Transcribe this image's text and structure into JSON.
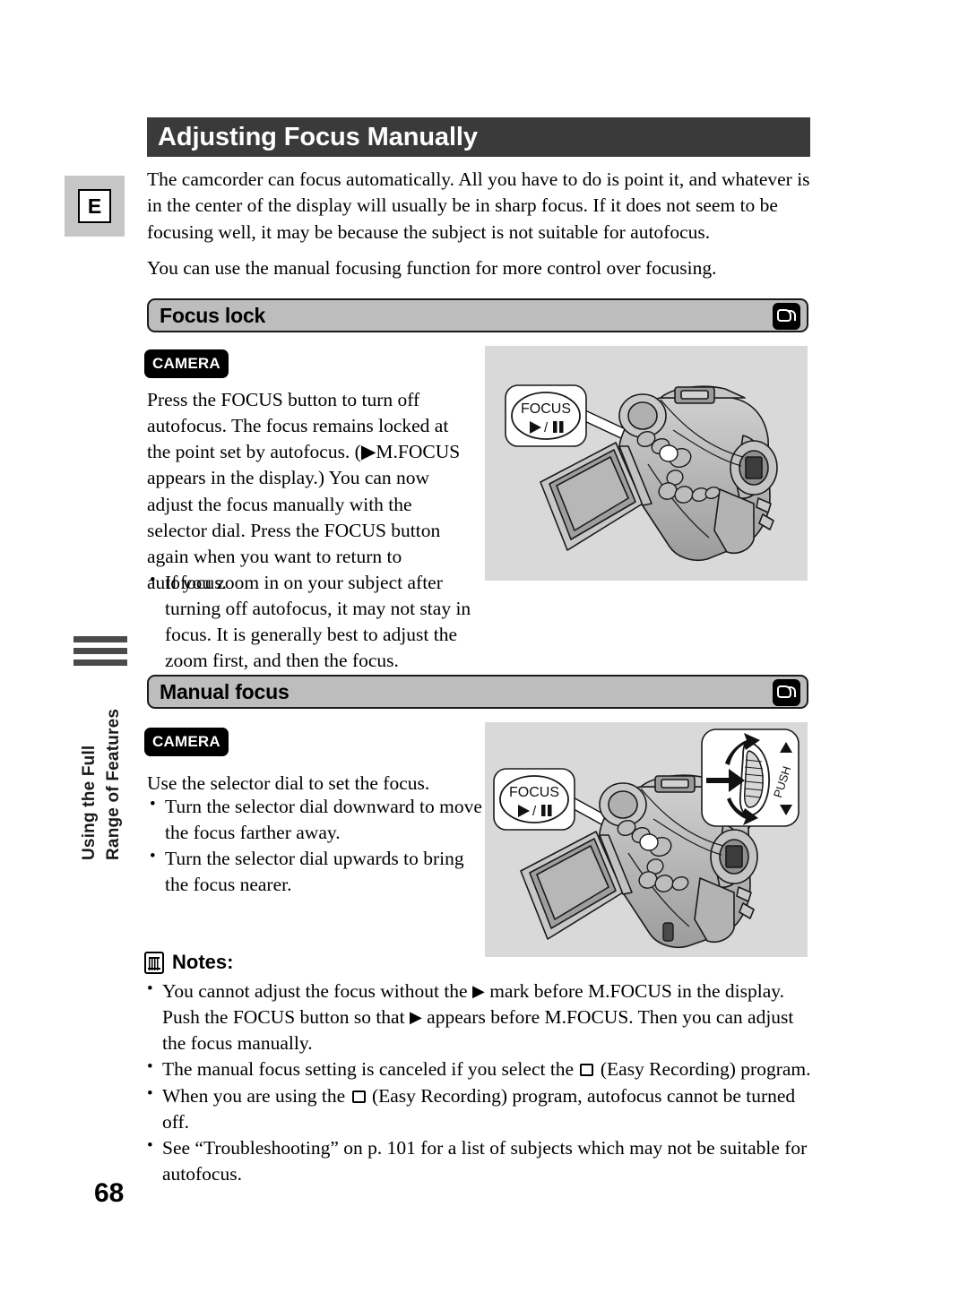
{
  "page": {
    "number": "68",
    "title": "Adjusting Focus Manually",
    "language_tab": "E",
    "side_label_line1": "Using the Full",
    "side_label_line2": "Range of Features"
  },
  "intro": {
    "paragraph1": "The camcorder can focus automatically. All you have to do is point it, and whatever is in the center of the display will usually be in sharp focus. If it does not seem to be focusing well, it may be because the subject is not suitable for autofocus.",
    "paragraph2": "You can use the manual focusing function for more control over focusing."
  },
  "focus_lock": {
    "heading": "Focus lock",
    "mode_badge": "CAMERA",
    "body": "Press the FOCUS button to turn off autofocus. The focus remains locked at the point set by autofocus. (▶M.FOCUS appears in the display.) You can now adjust the focus manually with the selector dial. Press the FOCUS button again when you want to return to autofocus.",
    "bullets": [
      "If you zoom in on your subject after turning off autofocus, it may not stay in focus. It is generally best to adjust the zoom first, and then the focus."
    ],
    "illustration": {
      "callout_label_line1": "FOCUS",
      "callout_label_line2": "▶/❙❙"
    }
  },
  "manual_focus": {
    "heading": "Manual focus",
    "mode_badge": "CAMERA",
    "body": "Use the selector dial to set the focus.",
    "bullets": [
      "Turn the selector dial downward to move the focus farther away.",
      "Turn the selector dial upwards to bring the focus nearer."
    ],
    "illustration": {
      "callout_label_line1": "FOCUS",
      "callout_label_line2": "▶/❙❙",
      "dial_label": "PUSH"
    }
  },
  "notes": {
    "heading": "Notes:",
    "items": [
      {
        "segments": [
          {
            "type": "text",
            "value": "You cannot adjust the focus without the "
          },
          {
            "type": "triangle",
            "value": "▶"
          },
          {
            "type": "text",
            "value": " mark before M.FOCUS in the display. Push the FOCUS button so that "
          },
          {
            "type": "triangle",
            "value": "▶"
          },
          {
            "type": "text",
            "value": " appears before M.FOCUS. Then you can adjust the focus manually."
          }
        ]
      },
      {
        "segments": [
          {
            "type": "text",
            "value": "The manual focus setting is canceled if you select the "
          },
          {
            "type": "square-icon",
            "value": ""
          },
          {
            "type": "text",
            "value": " (Easy Recording) program."
          }
        ]
      },
      {
        "segments": [
          {
            "type": "text",
            "value": "When you are using the "
          },
          {
            "type": "square-icon",
            "value": ""
          },
          {
            "type": "text",
            "value": " (Easy Recording) program, autofocus cannot be turned off."
          }
        ]
      },
      {
        "segments": [
          {
            "type": "text",
            "value": "See “Troubleshooting” on p. 101 for a list of subjects which may not be suitable for autofocus."
          }
        ]
      }
    ]
  },
  "colors": {
    "title_bar": "#3a3a3a",
    "section_bar": "#bdbdbd",
    "illustration_bg": "#d9d9d9",
    "lang_tab_bg": "#c6c6c6",
    "side_rule": "#4a4a4a"
  }
}
